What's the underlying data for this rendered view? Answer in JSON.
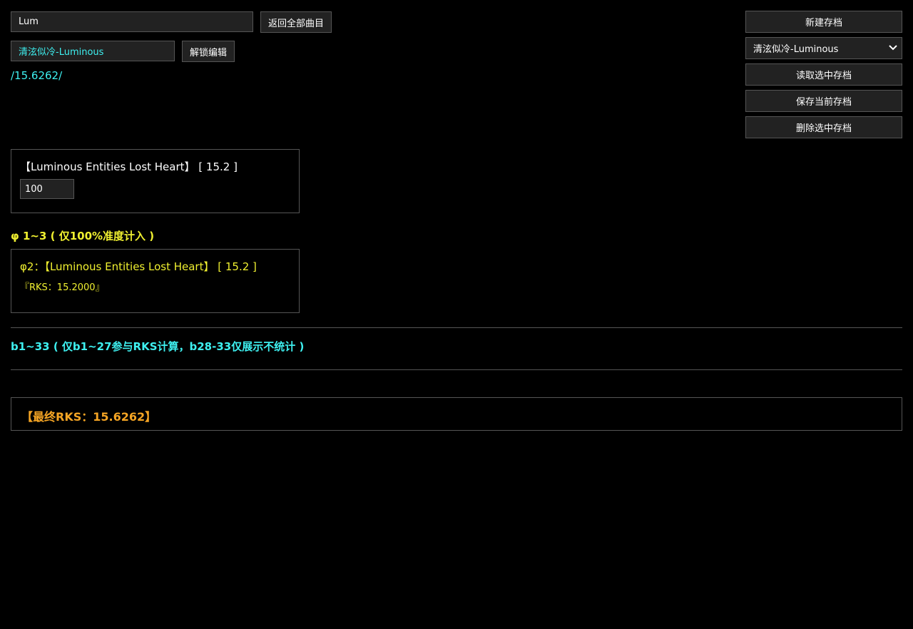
{
  "search": {
    "value": "Lum"
  },
  "back_button": {
    "label": "返回全部曲目"
  },
  "save_name": {
    "value": "清泫似冷-Luminous"
  },
  "unlock_button": {
    "label": "解锁编辑"
  },
  "rks_path": "/15.6262/",
  "right_panel": {
    "new_save": "新建存档",
    "selected_save": "清泫似冷-Luminous",
    "load_save": "读取选中存档",
    "store_save": "保存当前存档",
    "delete_save": "删除选中存档"
  },
  "song_card": {
    "title": "【Luminous Entities Lost Heart】",
    "level": "[ 15.2 ]",
    "accuracy": "100"
  },
  "phi_section": {
    "heading": "φ 1~3 ( 仅100%准度计入 )",
    "entry_prefix": "φ2：",
    "entry_title": "【Luminous Entities Lost Heart】",
    "entry_level": "[ 15.2 ]",
    "entry_rks": "『RKS：15.2000』"
  },
  "b_section": {
    "heading": "b1~33 ( 仅b1~27参与RKS计算，b28-33仅展示不统计 )"
  },
  "final": {
    "text": "【最终RKS：15.6262】"
  },
  "colors": {
    "cyan": "#3ef0f0",
    "yellow": "#f0f030",
    "orange": "#f5a524",
    "control_bg": "#222222",
    "border": "#555555"
  }
}
